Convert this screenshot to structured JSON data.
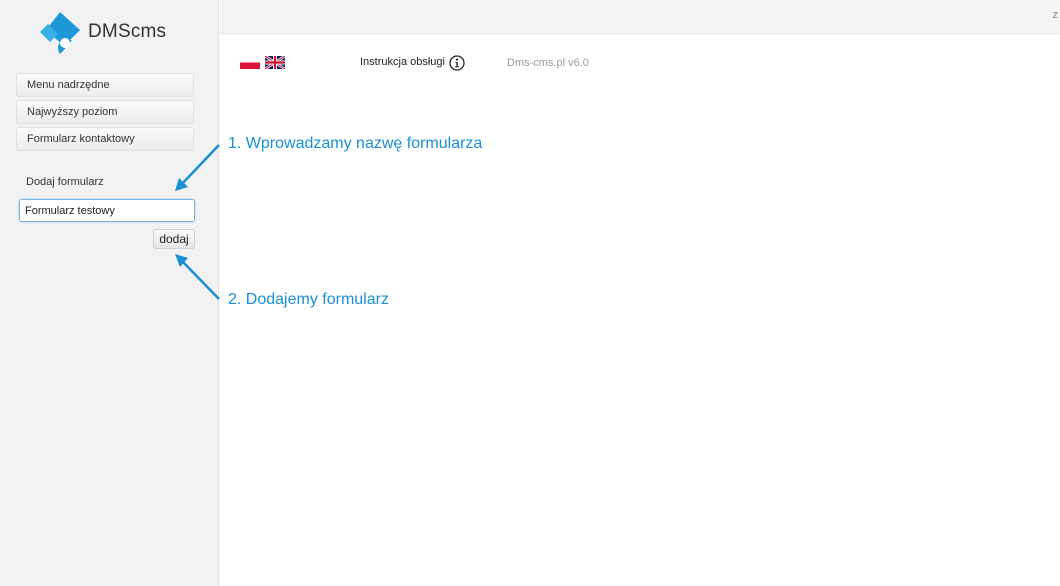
{
  "sidebar": {
    "logo_text": "DMScms",
    "items": [
      {
        "label": "Menu nadrzędne"
      },
      {
        "label": "Najwyższy poziom"
      },
      {
        "label": "Formularz kontaktowy"
      }
    ],
    "add_form": {
      "label": "Dodaj formularz",
      "input_value": "Formularz testowy",
      "button_label": "dodaj"
    }
  },
  "topbar": {
    "clipped_text": "z"
  },
  "header": {
    "languages": [
      {
        "icon": "flag-poland-icon"
      },
      {
        "icon": "flag-uk-icon"
      }
    ],
    "manual_label": "Instrukcja obsługi",
    "info_icon": "info-icon",
    "version": "Dms-cms.pl v6.0"
  },
  "annotations": [
    {
      "text": "1. Wprowadzamy nazwę formularza"
    },
    {
      "text": "2. Dodajemy formularz"
    }
  ],
  "colors": {
    "accent": "#1a8fd6",
    "logo": "#1e97d8",
    "sidebar_bg": "#f2f2f2"
  }
}
